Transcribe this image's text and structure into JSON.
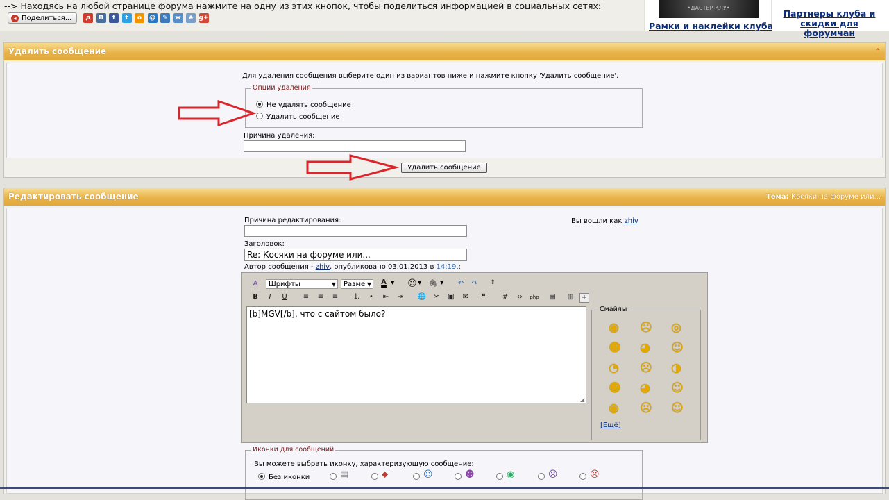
{
  "share": {
    "text": "--> Находясь на любой странице форума нажмите на одну из этих кнопок, чтобы поделиться информацией в социальных сетях:",
    "button_label": "Поделиться...",
    "networks": [
      {
        "label": "д",
        "color": "#d23a2c"
      },
      {
        "label": "В",
        "color": "#4b6f9b"
      },
      {
        "label": "f",
        "color": "#3b5998"
      },
      {
        "label": "t",
        "color": "#2fa0e4"
      },
      {
        "label": "о",
        "color": "#f29400"
      },
      {
        "label": "@",
        "color": "#2a78c2"
      },
      {
        "label": "✎",
        "color": "#3d7bbf"
      },
      {
        "label": "ж",
        "color": "#5a8ec7"
      },
      {
        "label": "♠",
        "color": "#7a9fc9"
      },
      {
        "label": "g+",
        "color": "#d34836"
      }
    ]
  },
  "ads": {
    "ad1_image_text": "•ДАСТЕР-КЛУ•",
    "ad1_link": "Рамки и наклейки клуба!",
    "ad2_link": "Партнеры клуба и скидки для форумчан"
  },
  "delete_section": {
    "title": "Удалить сообщение",
    "collapse_icon": "double-chevron-up",
    "instruction": "Для удаления сообщения выберите один из вариантов ниже и нажмите кнопку 'Удалить сообщение'.",
    "options_legend": "Опции удаления",
    "option_keep": "Не удалять сообщение",
    "option_delete": "Удалить сообщение",
    "reason_label": "Причина удаления:",
    "reason_value": "",
    "submit_label": "Удалить сообщение"
  },
  "edit_section": {
    "title": "Редактировать сообщение",
    "topic_label": "Тема:",
    "topic_value": "Косяки на форуме или...",
    "edit_reason_label": "Причина редактирования:",
    "edit_reason_value": "",
    "logged_in_prefix": "Вы вошли как",
    "username": "zhiv",
    "subject_label": "Заголовок:",
    "subject_value": "Re: Косяки на форуме или...",
    "author_prefix": "Автор сообщения -",
    "author_name": "zhiv",
    "published_text": ", опубликовано 03.01.2013 в",
    "published_time": "14:19",
    "published_suffix": ".:"
  },
  "editor": {
    "font_select": "Шрифты",
    "size_select": "Разме",
    "toolbar_row1": [
      "wysiwyg-toggle",
      "font-color",
      "smiley-menu",
      "attach-menu",
      "undo",
      "redo",
      "resize"
    ],
    "toolbar_row2": [
      "bold",
      "italic",
      "underline",
      "align-left",
      "align-center",
      "align-right",
      "ordered-list",
      "unordered-list",
      "outdent",
      "indent",
      "insert-link",
      "remove-link",
      "insert-image",
      "insert-email",
      "quote",
      "hash",
      "code",
      "php",
      "html",
      "spoiler",
      "more"
    ],
    "content": "[b]MGV[/b], что с сайтом было?",
    "smilies_legend": "Смайлы",
    "more_smilies": "[Ещё]"
  },
  "post_icons": {
    "legend": "Иконки для сообщений",
    "instruction": "Вы можете выбрать иконку, характеризующую сообщение:",
    "no_icon_label": "Без иконки"
  },
  "colors": {
    "header_gradient_top": "#f8dc8e",
    "header_gradient_bottom": "#e2a83a",
    "link": "#0b2e7a",
    "arrow": "#d9262c",
    "legend_text": "#7a1a1a"
  }
}
